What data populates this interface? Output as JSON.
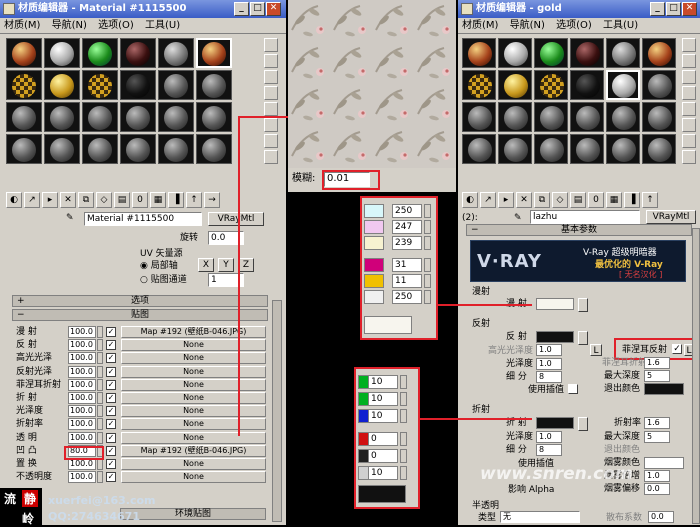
{
  "left_window": {
    "title": "材质编辑器 - Material #1115500",
    "menu": [
      "材质(M)",
      "导航(N)",
      "选项(O)",
      "工具(U)"
    ],
    "material_name": "Material #1115500",
    "material_type": "VRayMtl",
    "rotate_label": "旋转",
    "rotate_value": "0.0",
    "uv_group_label": "UV 矢量源",
    "uv_local_axis": "局部轴",
    "uv_map_channel": "贴图通道",
    "axis_x": "X",
    "axis_y": "Y",
    "axis_z": "Z",
    "channel_value": "1",
    "rollout_options": "选项",
    "rollout_maps": "贴图",
    "map_rows": [
      {
        "name": "漫 射",
        "value": "100.0",
        "checked": true,
        "map": "Map #192 (壁纸B-046.JPG)"
      },
      {
        "name": "反 射",
        "value": "100.0",
        "checked": true,
        "map": "None"
      },
      {
        "name": "高光光泽",
        "value": "100.0",
        "checked": true,
        "map": "None"
      },
      {
        "name": "反射光泽",
        "value": "100.0",
        "checked": true,
        "map": "None"
      },
      {
        "name": "菲涅耳折射",
        "value": "100.0",
        "checked": true,
        "map": "None"
      },
      {
        "name": "折 射",
        "value": "100.0",
        "checked": true,
        "map": "None"
      },
      {
        "name": "光泽度",
        "value": "100.0",
        "checked": true,
        "map": "None"
      },
      {
        "name": "折射率",
        "value": "100.0",
        "checked": true,
        "map": "None"
      },
      {
        "name": "透 明",
        "value": "100.0",
        "checked": true,
        "map": "None"
      },
      {
        "name": "凹 凸",
        "value": "80.0",
        "checked": true,
        "map": "Map #192 (壁纸B-046.JPG)"
      },
      {
        "name": "置 换",
        "value": "100.0",
        "checked": true,
        "map": "None"
      },
      {
        "name": "不透明度",
        "value": "100.0",
        "checked": true,
        "map": "None"
      }
    ],
    "bottom_row_label": "环境贴图"
  },
  "middle": {
    "blur_label": "模糊:",
    "blur_value": "0.01"
  },
  "swatch_popup_top": {
    "rows": [
      {
        "color": "#d8f7fa",
        "value": "250"
      },
      {
        "color": "#f1c8f0",
        "value": "247"
      },
      {
        "color": "#f7f2d0",
        "value": "239"
      },
      {
        "color": "#d0007a",
        "value": "31"
      },
      {
        "color": "#f0c000",
        "value": "11"
      },
      {
        "color": "#f0f0f0",
        "value": "250"
      }
    ],
    "result_color": "#f7f5ee"
  },
  "swatch_popup_bottom": {
    "rows": [
      {
        "color": "#00b020",
        "value": "10"
      },
      {
        "color": "#00b020",
        "value": "10"
      },
      {
        "color": "#1020d0",
        "value": "10"
      },
      {
        "color": "#d01010",
        "value": "0"
      },
      {
        "color": "#202020",
        "value": "0"
      },
      {
        "color": "#d0d0d0",
        "value": "10"
      }
    ],
    "result_color": "#111111"
  },
  "right_window": {
    "title": "材质编辑器 - gold",
    "menu": [
      "材质(M)",
      "导航(N)",
      "选项(O)",
      "工具(U)"
    ],
    "slot_index": "(2):",
    "material_name": "lazhu",
    "material_type": "VRayMtl",
    "rollout_basic": "基本参数",
    "vray_logo": "V·RAY",
    "vray_line1": "V-Ray 超级明暗器",
    "vray_line2": "最优化的 V-Ray",
    "vray_line3": "[ 无名汉化 ]",
    "diffuse_group": "漫射",
    "diffuse_label": "漫 射",
    "reflect_group": "反射",
    "reflect_label": "反 射",
    "hilight_label": "高光光泽度",
    "hilight_value": "1.0",
    "lock_label": "L",
    "fresnel_label": "菲涅耳反射",
    "fresnel_ior_label": "菲涅耳折射率",
    "fresnel_ior_value": "1.6",
    "refl_gloss_label": "光泽度",
    "refl_gloss_value": "1.0",
    "max_depth_label": "最大深度",
    "max_depth_value": "5",
    "subdivs_label": "细 分",
    "subdivs_value": "8",
    "exit_color_label": "退出颜色",
    "use_interp_label": "使用插值",
    "refract_group": "折射",
    "refract_label": "折 射",
    "ior_label": "折射率",
    "ior_value": "1.6",
    "refr_gloss_label": "光泽度",
    "refr_gloss_value": "1.0",
    "refr_max_depth_label": "最大深度",
    "refr_max_depth_value": "5",
    "refr_subdivs_label": "细 分",
    "refr_subdivs_value": "8",
    "refr_exit_label": "退出颜色",
    "refr_use_interp": "使用插值",
    "fog_color_label": "烟雾颜色",
    "fog_mult_label": "烟雾倍增",
    "fog_mult_value": "1.0",
    "fog_bias_label": "烟雾偏移",
    "fog_bias_value": "0.0",
    "affect_alpha": "影响 Alpha",
    "translucency_group": "半透明",
    "type_label": "类型",
    "type_value": "无",
    "scatter_label": "散布系数",
    "scatter_value": "0.0"
  },
  "watermark": {
    "left_text1": "流",
    "left_text2": "静",
    "left_text3": "岭",
    "email": "xuerfei@163.com",
    "qq": "QQ:274634671",
    "site": "www.snren.com"
  }
}
